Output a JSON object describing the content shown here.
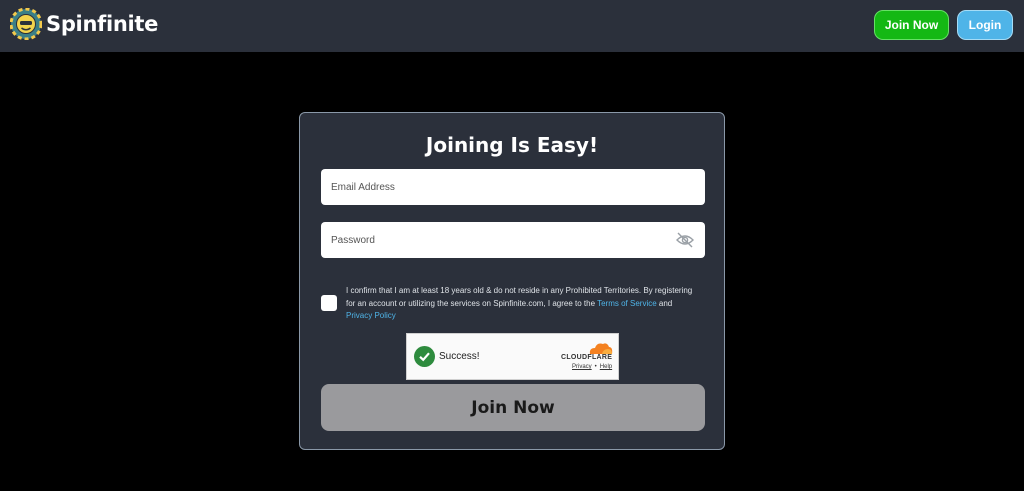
{
  "header": {
    "brand_name": "Spinfinite",
    "join_label": "Join Now",
    "login_label": "Login"
  },
  "form": {
    "title": "Joining Is Easy!",
    "email_placeholder": "Email Address",
    "password_placeholder": "Password",
    "consent_text": "I confirm that I am at least 18 years old & do not reside in any Prohibited Territories. By registering for an account or utilizing the services on Spinfinite.com, I agree to the ",
    "terms_link": "Terms of Service",
    "consent_and": " and ",
    "privacy_link": "Privacy Policy",
    "consent_checked": false,
    "submit_label": "Join Now"
  },
  "captcha": {
    "status": "Success!",
    "provider": "CLOUDFLARE",
    "privacy_link": "Privacy",
    "separator": "•",
    "help_link": "Help"
  },
  "icons": {
    "logo": "spinfinite-chip-logo",
    "password_toggle": "eye-slash-icon",
    "captcha_status": "check-circle-icon",
    "provider_logo": "cloudflare-cloud-icon"
  },
  "colors": {
    "join_button": "#14b814",
    "login_button": "#4fb4e8",
    "link": "#4fb4e8",
    "submit_disabled": "#9a9a9d",
    "card_bg": "#2b303b"
  }
}
